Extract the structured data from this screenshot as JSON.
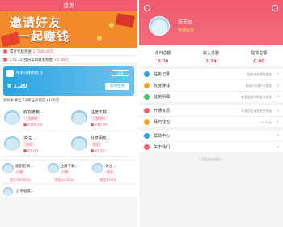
{
  "left": {
    "header_title": "首页",
    "banner_text_1": "邀请好友",
    "banner_text_2": "一起赚钱",
    "notices": [
      {
        "text": "累计奖励奖金",
        "value": "17388.38元"
      },
      {
        "text": "175...5 会员帮助联系佣金",
        "value": "+5.00元"
      }
    ],
    "wallet": {
      "title": "每单可赚佣金(元)",
      "share_label": "分享",
      "amount": "¥ 1.20",
      "withdraw_label": "提现任务"
    },
    "section_title": "酒好补要让下4新任务完成+100元",
    "cards": [
      {
        "name": "收割老赖...",
        "tag": "一般商家",
        "price": "¥100.00"
      },
      {
        "name": "注册下载...",
        "tag": "一般任务",
        "price": "¥10.00"
      },
      {
        "name": "关注...",
        "tag": "关注",
        "price": "¥1.00"
      },
      {
        "name": "分享朋友...",
        "tag": "关注",
        "price": "¥1.50"
      }
    ],
    "grid3": [
      {
        "name": "收割老赖...",
        "tag": "一般",
        "price": "佣金100.00元"
      },
      {
        "name": "注册下载...",
        "tag": "一般",
        "price": "佣金10.00元"
      },
      {
        "name": "关注...",
        "tag": "关注",
        "price": "佣金1.00元"
      }
    ],
    "last_item": "分享朋友..."
  },
  "right": {
    "user_name": "张无忌",
    "user_level": "普通会员",
    "stats": [
      {
        "label": "今日总额",
        "value": "0.00"
      },
      {
        "label": "收入总额",
        "value": "1.34"
      },
      {
        "label": "提现总额",
        "value": "0.00"
      }
    ],
    "menu_group_1": [
      {
        "label": "任务记录",
        "value": "完成任务赚取佣金",
        "color": "#2aa3e0"
      },
      {
        "label": "收徒赚钱",
        "value": "邀请好友赚5%佣金",
        "color": "#f5a623"
      },
      {
        "label": "徒弟明细",
        "value": "查看徒弟的数量与收益",
        "color": "#43c06b"
      }
    ],
    "menu_group_2": [
      {
        "label": "开通会员",
        "value": "开通会员享受更多权益",
        "color": "#f25a70"
      },
      {
        "label": "我的钱包",
        "value": "11.34元",
        "color": "#f5a623"
      }
    ],
    "menu_group_3": [
      {
        "label": "帮助中心",
        "value": "",
        "color": "#2aa3e0"
      },
      {
        "label": "关于我们",
        "value": "",
        "color": "#f25a70"
      }
    ],
    "footer": "—我是有底线的—"
  }
}
